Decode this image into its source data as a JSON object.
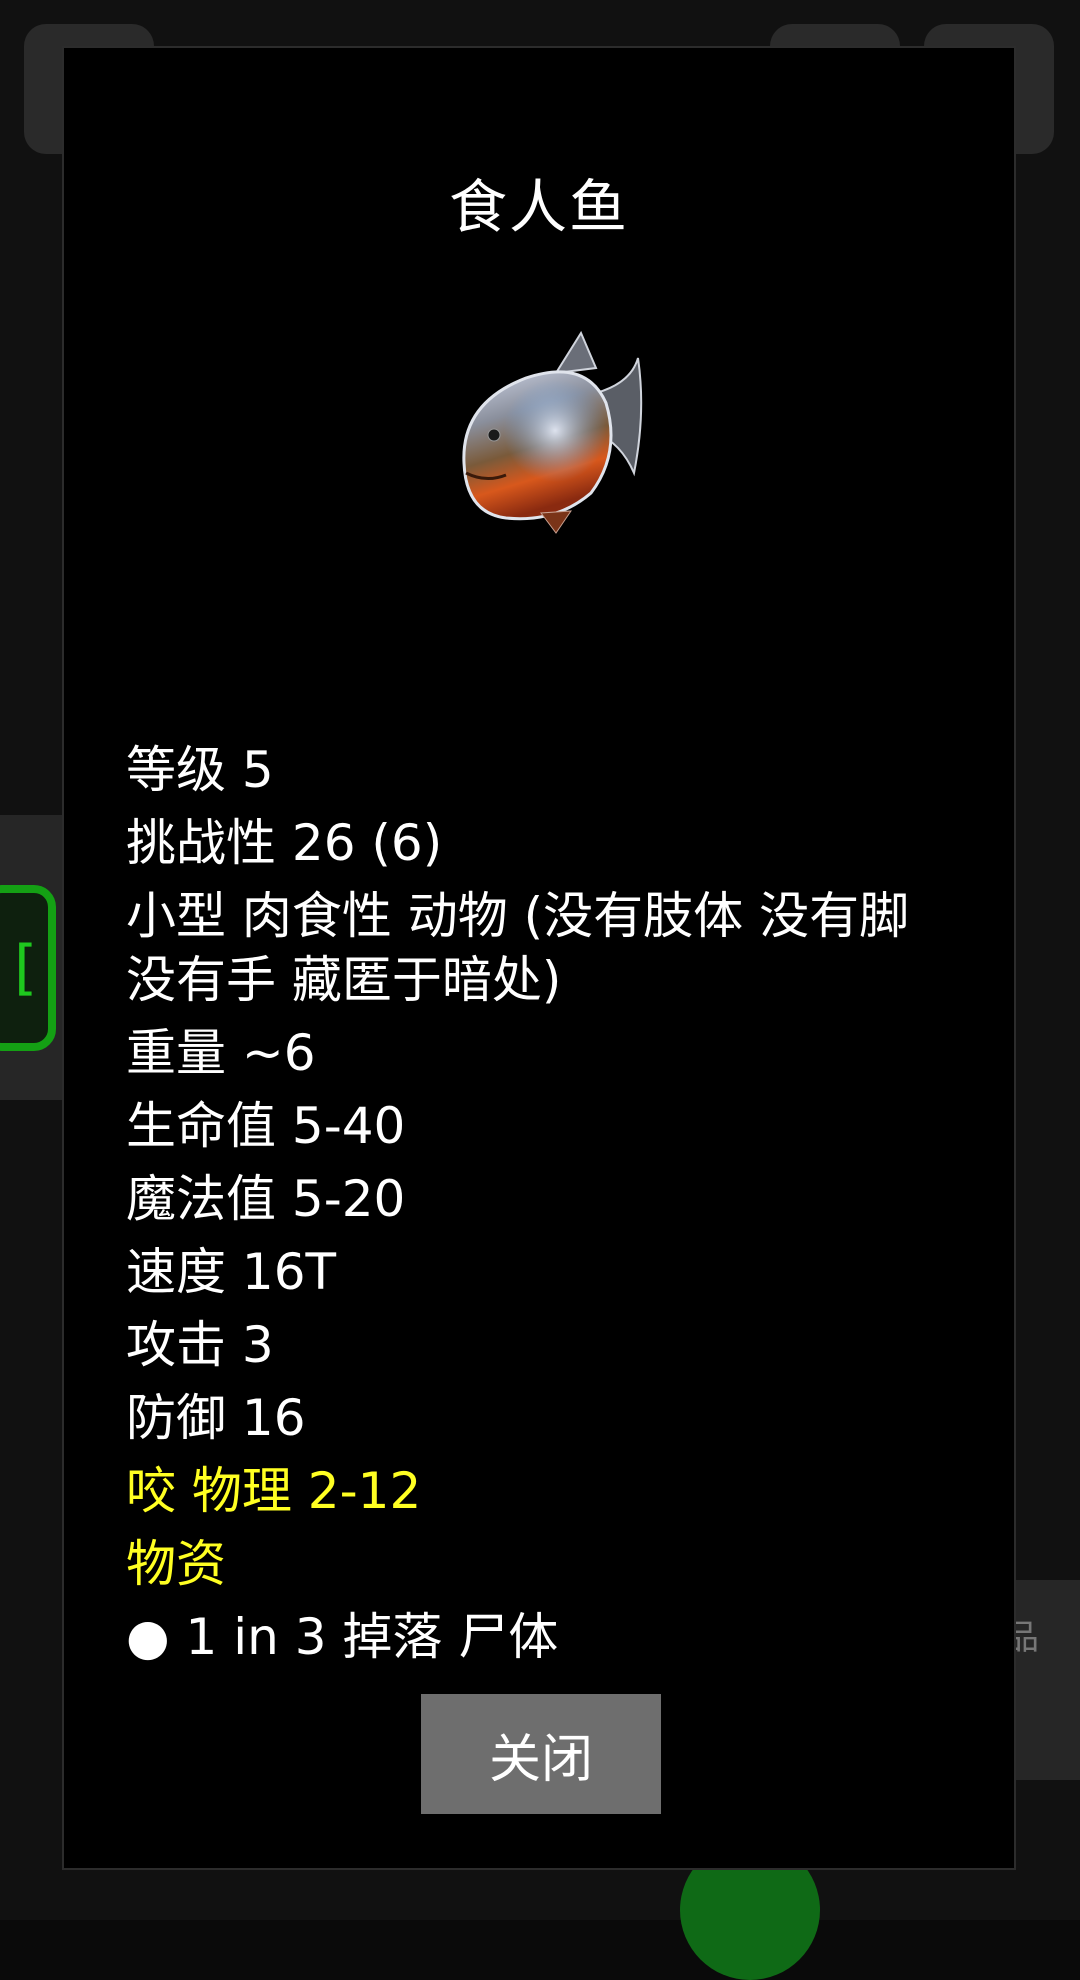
{
  "dialog": {
    "title": "食人鱼",
    "creature_icon": "piranha-icon",
    "stats": {
      "level": "等级 5",
      "challenge": "挑战性 26 (6)",
      "traits": "小型 肉食性 动物 (没有肢体 没有脚 没有手 藏匿于暗处)",
      "weight": "重量 ~6",
      "hp": "生命值 5-40",
      "mp": "魔法值 5-20",
      "speed": "速度 16T",
      "attack": "攻击 3",
      "defense": "防御 16",
      "bite": "咬 物理 2-12",
      "resources_header": "物资",
      "drop": "● 1 in 3 掉落 尸体"
    },
    "close_label": "关闭"
  },
  "background": {
    "side_label": "品"
  },
  "colors": {
    "highlight": "#ffff22",
    "text": "#ffffff",
    "button": "#6e6e6e",
    "green_accent": "#14a014"
  }
}
